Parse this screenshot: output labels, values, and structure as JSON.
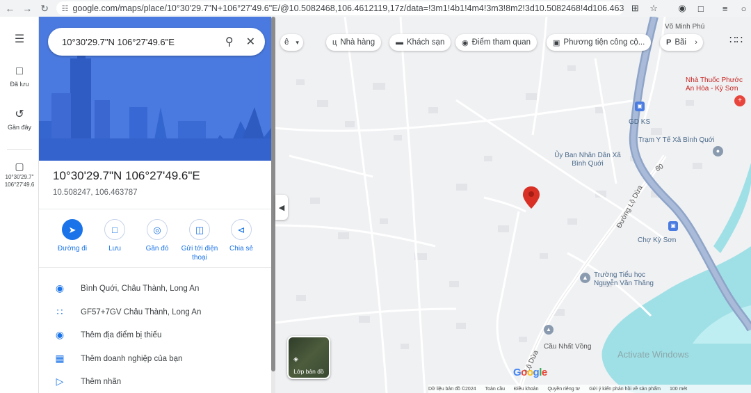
{
  "browser": {
    "url": "google.com/maps/place/10°30'29.7\"N+106°27'49.6\"E/@10.5082468,106.4612119,17z/data=!3m1!4b1!4m4!3m3!8m2!3d10.5082468!4d106.4637868?..."
  },
  "rail": {
    "saved_label": "Đã lưu",
    "recent_label": "Gần đây",
    "history_label": "10°30'29.7\" 106°27'49.6"
  },
  "search": {
    "query": "10°30'29.7\"N 106°27'49.6\"E"
  },
  "place": {
    "title": "10°30'29.7\"N 106°27'49.6\"E",
    "coords": "10.508247, 106.463787"
  },
  "actions": [
    {
      "label": "Đường đi"
    },
    {
      "label": "Lưu"
    },
    {
      "label": "Gần đó"
    },
    {
      "label": "Gửi tới điện thoại"
    },
    {
      "label": "Chia sẻ"
    }
  ],
  "info": [
    {
      "text": "Bình Quới, Châu Thành, Long An",
      "icon": "pin-icon"
    },
    {
      "text": "GF57+7GV Châu Thành, Long An",
      "icon": "plus-code-icon"
    },
    {
      "text": "Thêm địa điểm bị thiếu",
      "icon": "add-place-icon"
    },
    {
      "text": "Thêm doanh nghiệp của bạn",
      "icon": "business-icon"
    },
    {
      "text": "Thêm nhãn",
      "icon": "label-icon"
    }
  ],
  "chips": [
    {
      "label": "Nhà hàng",
      "icon": "restaurant-icon"
    },
    {
      "label": "Khách sạn",
      "icon": "hotel-icon"
    },
    {
      "label": "Điểm tham quan",
      "icon": "camera-icon"
    },
    {
      "label": "Phương tiện công cộ...",
      "icon": "bus-icon"
    },
    {
      "label": "Bãi",
      "icon": "parking-icon"
    }
  ],
  "map_labels": {
    "vo_minh_phu": "Võ Minh Phú",
    "pharmacy": "Nhà Thuốc Phước An Hòa - Kỳ Sơn",
    "gd_ks": "GD KS",
    "tram_y_te": "Trạm Y Tế Xã Bình Quới",
    "uy_ban": "Ủy Ban Nhân Dân Xã Bình Quới",
    "duong_lo_dua": "Đường Lộ Dừa",
    "road_80": "80",
    "cho_ky_son": "Chợ Kỳ Sơn",
    "truong": "Trường Tiểu học Nguyễn Văn Thăng",
    "cau": "Cầu Nhất Vồng",
    "lo_dua": "Lộ Dừa",
    "layers": "Lớp bản đồ",
    "google": "Google",
    "watermark": "Activate Windows"
  },
  "footer": {
    "data": "Dữ liệu bản đồ ©2024",
    "all": "Toàn cầu",
    "terms": "Điều khoản",
    "privacy": "Quyền riêng tư",
    "feedback": "Gửi ý kiến phản hồi về sản phẩm",
    "scale": "100 mét"
  },
  "colors": {
    "accent": "#1a73e8",
    "hero": "#3b6bd9",
    "water": "#9fe0e6",
    "highway": "#8ea4c8",
    "pin": "#d93025"
  }
}
